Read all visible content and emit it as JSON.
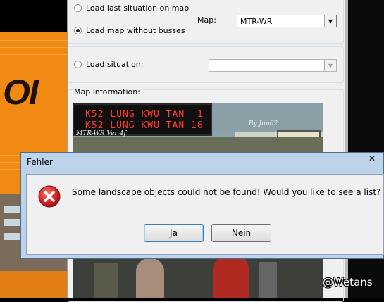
{
  "map_dialog": {
    "option_load_last": "Load last situation on map",
    "option_load_no_busses": "Load map without busses",
    "map_label": "Map:",
    "map_value": "MTR-WR",
    "option_load_situation": "Load situation:",
    "situation_value": "",
    "map_info_label": "Map information:"
  },
  "preview": {
    "led_line1": "K52 LUNG KWU TAN  1",
    "led_line2": "K52 LUNG KWU TAN 16",
    "sign_left": "MTR-WR Ver 4f",
    "sign_right": "By Jun62"
  },
  "background": {
    "logo_text": "OI"
  },
  "error_dialog": {
    "title": "Fehler",
    "close_glyph": "✕",
    "message": "Some landscape objects could not be found! Would you like to see a list?",
    "yes_mnemonic": "J",
    "yes_rest": "a",
    "no_mnemonic": "N",
    "no_rest": "ein"
  },
  "watermark": "@Wetans",
  "icons": {
    "error": "error-icon",
    "combo_arrow": "chevron-down-icon",
    "close": "close-icon"
  },
  "colors": {
    "title_bar": "#bcd3ea",
    "error_red": "#d9262a",
    "background_orange": "#f08a12"
  }
}
